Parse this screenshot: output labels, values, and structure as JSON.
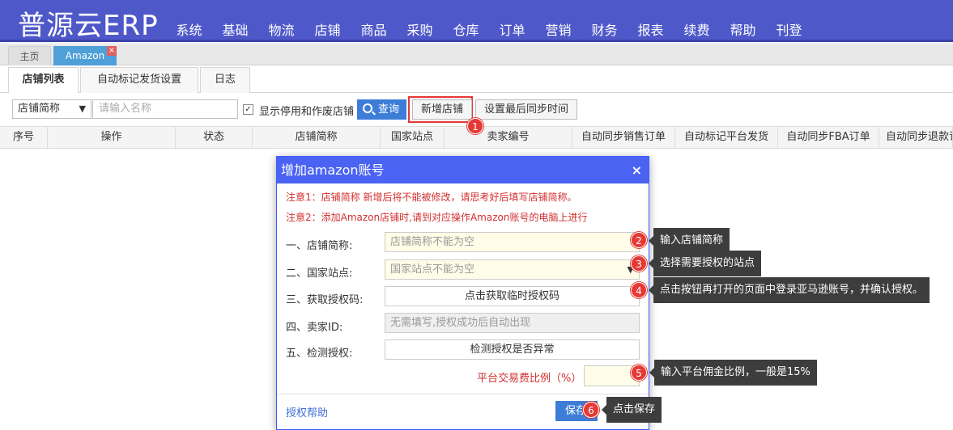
{
  "app": {
    "logo": "普源云ERP"
  },
  "nav": [
    "系统",
    "基础",
    "物流",
    "店铺",
    "商品",
    "采购",
    "仓库",
    "订单",
    "营销",
    "财务",
    "报表",
    "续费",
    "帮助",
    "刊登"
  ],
  "page_tabs": {
    "home": "主页",
    "amazon": "Amazon",
    "close": "×"
  },
  "sub_tabs": [
    "店铺列表",
    "自动标记发货设置",
    "日志"
  ],
  "toolbar": {
    "select_value": "店铺简称",
    "search_placeholder": "请输入名称",
    "show_disabled_label": "显示停用和作废店铺",
    "show_disabled_checked": true,
    "query_label": "查询",
    "add_store_label": "新增店铺",
    "set_sync_label": "设置最后同步时间"
  },
  "table": {
    "columns": [
      "序号",
      "操作",
      "状态",
      "店铺简称",
      "国家站点",
      "卖家编号",
      "自动同步销售订单",
      "自动标记平台发货",
      "自动同步FBA订单",
      "自动同步退款订单"
    ]
  },
  "modal": {
    "title": "增加amazon账号",
    "close": "×",
    "note1": "注意1：店铺简称 新增后将不能被修改，请思考好后填写店铺简称。",
    "note2": "注意2：添加Amazon店铺时,请到对应操作Amazon账号的电脑上进行",
    "fields": {
      "store_label": "一、店铺简称:",
      "store_placeholder": "店铺简称不能为空",
      "site_label": "二、国家站点:",
      "site_placeholder": "国家站点不能为空",
      "auth_label": "三、获取授权码:",
      "auth_button": "点击获取临时授权码",
      "seller_label": "四、卖家ID:",
      "seller_placeholder": "无需填写,授权成功后自动出现",
      "check_label": "五、检测授权:",
      "check_button": "检测授权是否异常"
    },
    "fee_label": "平台交易费比例（%）",
    "help_link": "授权帮助",
    "save_label": "保存"
  },
  "steps": [
    {
      "num": "1",
      "text": ""
    },
    {
      "num": "2",
      "text": "输入店铺简称"
    },
    {
      "num": "3",
      "text": "选择需要授权的站点"
    },
    {
      "num": "4",
      "text": "点击按钮再打开的页面中登录亚马逊账号，并确认授权。"
    },
    {
      "num": "5",
      "text": "输入平台佣金比例，一般是15%"
    },
    {
      "num": "6",
      "text": "点击保存"
    }
  ],
  "colors": {
    "header": "#4f58c9",
    "modal_header": "#4a63f3",
    "accent": "#3d7dd8",
    "badge": "#e53935",
    "note": "#d32f2f"
  }
}
